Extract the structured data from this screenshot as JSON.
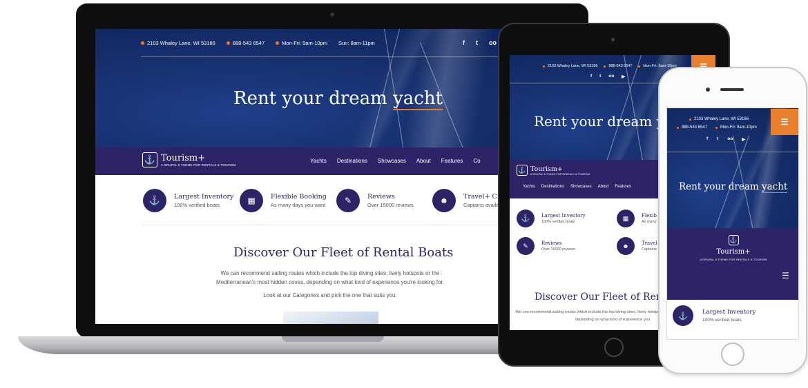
{
  "site": {
    "address": "2103 Whaley Lane, WI 53186",
    "phone": "888-543 6547",
    "hours_weekday": "Mon-Fri: 9am-10pm",
    "hours_sunday": "Sun: 8am-11pm",
    "hero_title_pre": "Rent your dream ",
    "hero_title_word": "yacht",
    "logo_name": "Tourism+",
    "logo_tagline": "A Drupal 8 theme for rentals & tourism",
    "social": {
      "facebook": "f",
      "twitter": "t",
      "tripadvisor": "oo",
      "youtube": "▶"
    },
    "menu": [
      "Yachts",
      "Destinations",
      "Showcases",
      "About",
      "Features",
      "Co"
    ],
    "features": [
      {
        "title": "Largest Inventory",
        "subtitle": "100% verified boats",
        "icon": "anchor-icon"
      },
      {
        "title": "Flexible Booking",
        "subtitle": "As many days you want",
        "icon": "calendar-icon"
      },
      {
        "title": "Reviews",
        "subtitle": "Over 15000 reviews",
        "icon": "pencil-icon"
      },
      {
        "title": "Travel+ Crew",
        "subtitle": "Captains available",
        "icon": "group-icon"
      }
    ],
    "section_title": "Discover Our Fleet of Rental Boats",
    "section_text_1": "We can recommend sailing routes which include the top diving sites, lively hotspots or the Mediterranean's most hidden coves, depending on what kind of experience you're looking for.",
    "section_text_2": "Look at our Categories and pick the one that suits you."
  },
  "tablet": {
    "address": "2103 Whaley Lane, WI 53186",
    "phone": "888-543 6547",
    "hours": "Mon-Fri: 9am-10pm",
    "hero_title": "Rent your dream y",
    "menu": [
      "Yachts",
      "Destinations",
      "Showcases",
      "About",
      "Features"
    ],
    "features": [
      {
        "title": "Largest Inventory",
        "subtitle": "100% verified boats"
      },
      {
        "title": "Flexib",
        "subtitle": "As many"
      },
      {
        "title": "Reviews",
        "subtitle": "Over 15000 reviews"
      },
      {
        "title": "Travel",
        "subtitle": "Captains"
      }
    ],
    "section_title": "Discover Our Fleet of Renta",
    "section_text": "We can recommend sailing routes which include the top diving sites, lively hotspots or the most hidden coves, depending on what kind of experience you"
  },
  "phone": {
    "address": "2103 Whaley Lane, WI 53186",
    "phone": "888-543 6547",
    "hours": "Mon-Fri: 9am-10pm",
    "hero_title_pre": "Rent your dream ",
    "hero_title_word": "yacht",
    "logo_name": "Tourism+",
    "logo_tagline": "A Drupal 8 theme for rentals & tourism",
    "feature_title": "Largest Inventory",
    "feature_subtitle": "100% verified boats"
  },
  "icons": {
    "menu": "☰",
    "anchor": "⚓",
    "calendar": "▦",
    "pencil": "✎",
    "group": "☻",
    "caret": "⌄"
  },
  "colors": {
    "navy": "#2c2466",
    "accent": "#ea7f2d",
    "sea": "#17306f"
  }
}
